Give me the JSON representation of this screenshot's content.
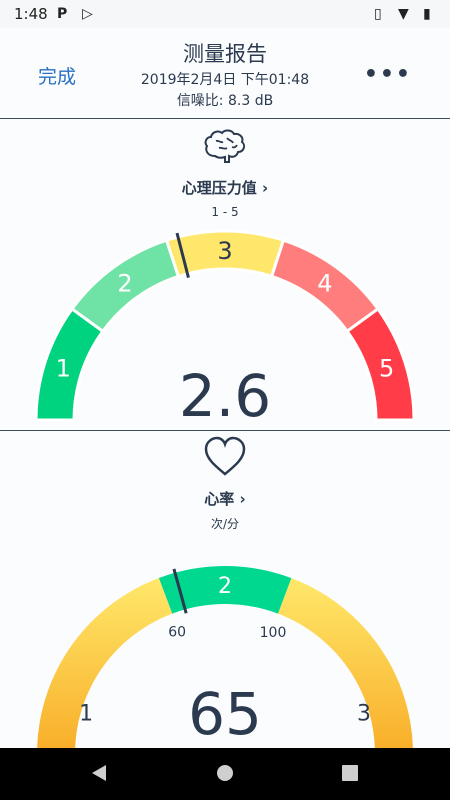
{
  "status_bar": {
    "time": "1:48",
    "left_icons": [
      "parking-icon",
      "play-store-icon"
    ],
    "right_icons": [
      "vibrate-icon",
      "wifi-icon",
      "battery-icon"
    ]
  },
  "header": {
    "done_label": "完成",
    "title": "测量报告",
    "datetime": "2019年2月4日 下午01:48",
    "snr": "信噪比: 8.3 dB",
    "more_label": "•••"
  },
  "stress": {
    "icon": "brain-icon",
    "label": "心理压力值 ›",
    "range": "1 - 5",
    "value": "2.6",
    "value_number": 2.6,
    "gauge_min": 0.5,
    "gauge_max": 5.5,
    "segments": [
      {
        "label": "1",
        "color": "#00d37f"
      },
      {
        "label": "2",
        "color": "#6fe2a5"
      },
      {
        "label": "3",
        "color": "#ffe76b"
      },
      {
        "label": "4",
        "color": "#ff7d7d"
      },
      {
        "label": "5",
        "color": "#ff3c47"
      }
    ]
  },
  "heart": {
    "icon": "heart-icon",
    "label": "心率 ›",
    "unit": "次/分",
    "value": "65",
    "value_number": 65,
    "threshold_low": "60",
    "threshold_high": "100",
    "zone_labels": [
      "1",
      "2",
      "3"
    ],
    "colors": {
      "mid": "#00d890",
      "top_side": "#ffe86a",
      "bottom_side": "#f7a21c"
    }
  },
  "nav": {
    "icons": [
      "back-icon",
      "home-icon",
      "recents-icon"
    ]
  }
}
